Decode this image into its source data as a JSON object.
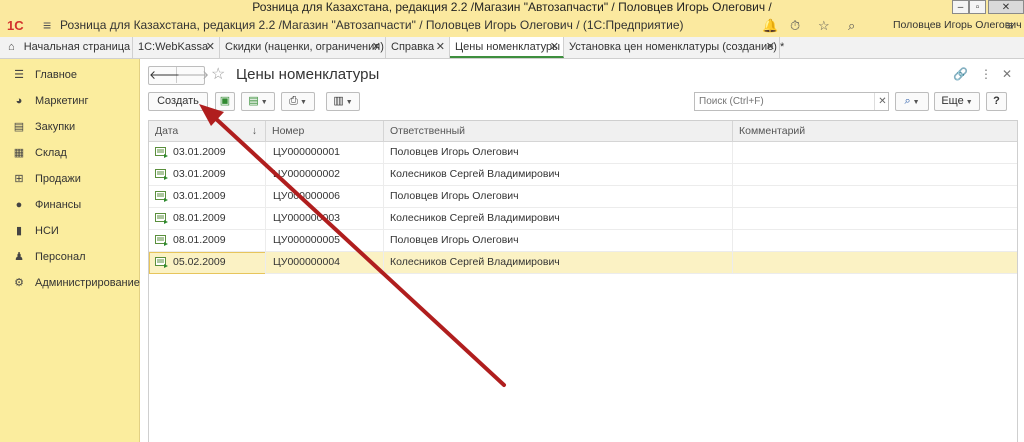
{
  "window": {
    "title": "Розница для Казахстана, редакция 2.2 /Магазин \"Автозапчасти\" / Половцев Игорь Олегович /"
  },
  "appbar": {
    "logo": "1С",
    "title": "Розница для Казахстана, редакция 2.2 /Магазин \"Автозапчасти\" / Половцев Игорь Олегович /  (1С:Предприятие)",
    "user": "Половцев Игорь Олегович"
  },
  "tabs": [
    {
      "label": "Начальная страница"
    },
    {
      "label": "1С:WebKassa"
    },
    {
      "label": "Скидки (наценки, ограничения)"
    },
    {
      "label": "Справка"
    },
    {
      "label": "Цены номенклатуры"
    },
    {
      "label": "Установка цен номенклатуры (создание) *"
    }
  ],
  "sidebar": {
    "items": [
      {
        "label": "Главное",
        "icon": "menu-icon"
      },
      {
        "label": "Маркетинг",
        "icon": "pie-chart-icon"
      },
      {
        "label": "Закупки",
        "icon": "purchases-icon"
      },
      {
        "label": "Склад",
        "icon": "warehouse-icon"
      },
      {
        "label": "Продажи",
        "icon": "basket-icon"
      },
      {
        "label": "Финансы",
        "icon": "coin-icon"
      },
      {
        "label": "НСИ",
        "icon": "book-icon"
      },
      {
        "label": "Персонал",
        "icon": "person-icon"
      },
      {
        "label": "Администрирование",
        "icon": "gear-icon"
      }
    ]
  },
  "page": {
    "title": "Цены номенклатуры"
  },
  "toolbar": {
    "create_label": "Создать",
    "search_placeholder": "Поиск (Ctrl+F)",
    "more_label": "Еще",
    "help_label": "?"
  },
  "table": {
    "columns": [
      {
        "label": "Дата"
      },
      {
        "label": "Номер"
      },
      {
        "label": "Ответственный"
      },
      {
        "label": "Комментарий"
      }
    ],
    "rows": [
      {
        "date": "03.01.2009",
        "number": "ЦУ000000001",
        "responsible": "Половцев Игорь Олегович",
        "comment": ""
      },
      {
        "date": "03.01.2009",
        "number": "ЦУ000000002",
        "responsible": "Колесников Сергей Владимирович",
        "comment": ""
      },
      {
        "date": "03.01.2009",
        "number": "ЦУ000000006",
        "responsible": "Половцев Игорь Олегович",
        "comment": ""
      },
      {
        "date": "08.01.2009",
        "number": "ЦУ000000003",
        "responsible": "Колесников Сергей Владимирович",
        "comment": ""
      },
      {
        "date": "08.01.2009",
        "number": "ЦУ000000005",
        "responsible": "Половцев Игорь Олегович",
        "comment": ""
      },
      {
        "date": "05.02.2009",
        "number": "ЦУ000000004",
        "responsible": "Колесников Сергей Владимирович",
        "comment": ""
      }
    ]
  },
  "colors": {
    "accent_yellow": "#fbe99f",
    "arrow_red": "#b01e1e",
    "selected_row": "#fbf2c4"
  }
}
